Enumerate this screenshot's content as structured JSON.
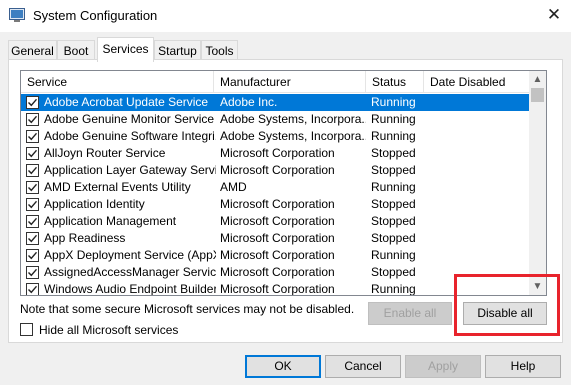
{
  "window": {
    "title": "System Configuration",
    "close_glyph": "✕",
    "icon": "system-configuration-icon"
  },
  "tabs": [
    {
      "label": "General",
      "active": false
    },
    {
      "label": "Boot",
      "active": false
    },
    {
      "label": "Services",
      "active": true
    },
    {
      "label": "Startup",
      "active": false
    },
    {
      "label": "Tools",
      "active": false
    }
  ],
  "services_list": {
    "columns": [
      "Service",
      "Manufacturer",
      "Status",
      "Date Disabled"
    ],
    "rows": [
      {
        "checked": true,
        "service": "Adobe Acrobat Update Service",
        "manufacturer": "Adobe Inc.",
        "status": "Running",
        "date_disabled": "",
        "selected": true
      },
      {
        "checked": true,
        "service": "Adobe Genuine Monitor Service",
        "manufacturer": "Adobe Systems, Incorpora...",
        "status": "Running",
        "date_disabled": ""
      },
      {
        "checked": true,
        "service": "Adobe Genuine Software Integri...",
        "manufacturer": "Adobe Systems, Incorpora...",
        "status": "Running",
        "date_disabled": ""
      },
      {
        "checked": true,
        "service": "AllJoyn Router Service",
        "manufacturer": "Microsoft Corporation",
        "status": "Stopped",
        "date_disabled": ""
      },
      {
        "checked": true,
        "service": "Application Layer Gateway Service",
        "manufacturer": "Microsoft Corporation",
        "status": "Stopped",
        "date_disabled": ""
      },
      {
        "checked": true,
        "service": "AMD External Events Utility",
        "manufacturer": "AMD",
        "status": "Running",
        "date_disabled": ""
      },
      {
        "checked": true,
        "service": "Application Identity",
        "manufacturer": "Microsoft Corporation",
        "status": "Stopped",
        "date_disabled": ""
      },
      {
        "checked": true,
        "service": "Application Management",
        "manufacturer": "Microsoft Corporation",
        "status": "Stopped",
        "date_disabled": ""
      },
      {
        "checked": true,
        "service": "App Readiness",
        "manufacturer": "Microsoft Corporation",
        "status": "Stopped",
        "date_disabled": ""
      },
      {
        "checked": true,
        "service": "AppX Deployment Service (AppX...",
        "manufacturer": "Microsoft Corporation",
        "status": "Running",
        "date_disabled": ""
      },
      {
        "checked": true,
        "service": "AssignedAccessManager Service",
        "manufacturer": "Microsoft Corporation",
        "status": "Stopped",
        "date_disabled": ""
      },
      {
        "checked": true,
        "service": "Windows Audio Endpoint Builder",
        "manufacturer": "Microsoft Corporation",
        "status": "Running",
        "date_disabled": ""
      }
    ]
  },
  "note": "Note that some secure Microsoft services may not be disabled.",
  "buttons": {
    "enable_all": "Enable all",
    "disable_all": "Disable all",
    "ok": "OK",
    "cancel": "Cancel",
    "apply": "Apply",
    "help": "Help"
  },
  "hide_ms_services": {
    "label": "Hide all Microsoft services",
    "checked": false
  },
  "colors": {
    "selection": "#0078d7",
    "highlight_box": "#e8232c"
  }
}
